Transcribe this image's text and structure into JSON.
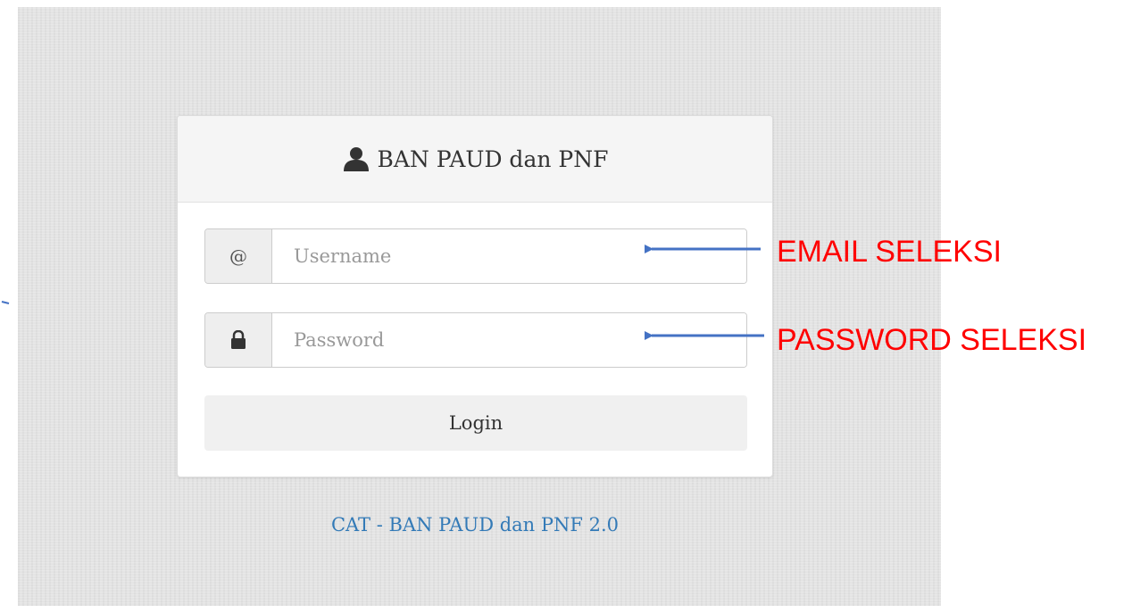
{
  "login_card": {
    "title": "BAN PAUD dan PNF",
    "username_addon": "@",
    "username_placeholder": "Username",
    "password_placeholder": "Password",
    "login_label": "Login"
  },
  "footer": {
    "text": "CAT - BAN PAUD dan PNF 2.0"
  },
  "annotations": {
    "email_label": "EMAIL SELEKSI",
    "password_label": "PASSWORD SELEKSI",
    "color": "#ff0000",
    "arrow_color": "#4472c4"
  },
  "icons": {
    "header": "user-icon",
    "password_addon": "lock-icon"
  }
}
